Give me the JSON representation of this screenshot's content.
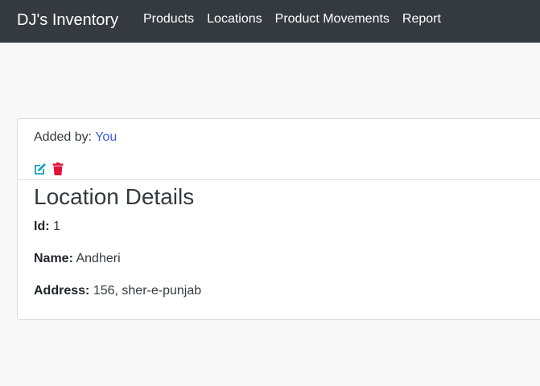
{
  "navbar": {
    "brand": "DJ's Inventory",
    "links": [
      "Products",
      "Locations",
      "Product Movements",
      "Report"
    ]
  },
  "card": {
    "added_by_label": "Added by:",
    "added_by_value": "You",
    "actions": {
      "edit_icon": "edit-icon",
      "delete_icon": "trash-icon"
    },
    "title": "Location Details",
    "fields": [
      {
        "label": "Id:",
        "value": "1"
      },
      {
        "label": "Name:",
        "value": "Andheri"
      },
      {
        "label": "Address:",
        "value": "156, sher-e-punjab"
      }
    ]
  },
  "colors": {
    "navbar_bg": "#343a40",
    "page_bg": "#f8f8f8",
    "link_accent": "#3b5bdb",
    "edit_icon": "#17a2b8",
    "delete_icon": "#dc143c"
  }
}
